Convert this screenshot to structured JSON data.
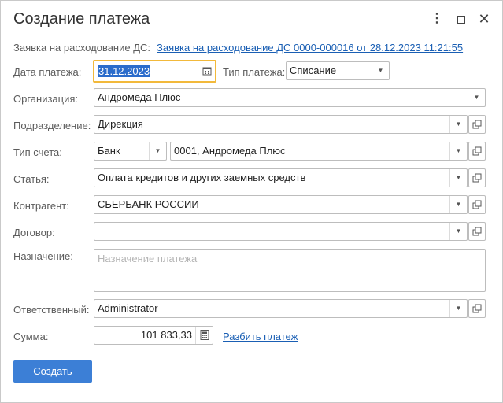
{
  "window": {
    "title": "Создание платежа",
    "menu_icon": "more-vertical-icon",
    "maximize_icon": "maximize-icon",
    "close_icon": "close-icon"
  },
  "request": {
    "label": "Заявка на расходование ДС:",
    "link": "Заявка на расходование ДС 0000-000016 от 28.12.2023 11:21:55"
  },
  "payment_date": {
    "label": "Дата платежа:",
    "value": "31.12.2023",
    "icon": "calendar-icon"
  },
  "payment_type": {
    "label": "Тип платежа:",
    "value": "Списание"
  },
  "organization": {
    "label": "Организация:",
    "value": "Андромеда Плюс"
  },
  "department": {
    "label": "Подразделение:",
    "value": "Дирекция"
  },
  "account_type": {
    "label": "Тип счета:",
    "type_value": "Банк",
    "account_value": "0001, Андромеда Плюс"
  },
  "article": {
    "label": "Статья:",
    "value": "Оплата кредитов и других заемных средств"
  },
  "counterparty": {
    "label": "Контрагент:",
    "value": "СБЕРБАНК РОССИИ"
  },
  "contract": {
    "label": "Договор:",
    "value": ""
  },
  "purpose": {
    "label": "Назначение:",
    "placeholder": "Назначение платежа"
  },
  "responsible": {
    "label": "Ответственный:",
    "value": "Administrator"
  },
  "amount": {
    "label": "Сумма:",
    "value": "101 833,33",
    "icon": "calculator-icon",
    "split_link": "Разбить платеж"
  },
  "actions": {
    "create": "Создать"
  },
  "colors": {
    "accent": "#3c7fd6",
    "link": "#1a5fb4",
    "focus": "#f2b93b"
  }
}
